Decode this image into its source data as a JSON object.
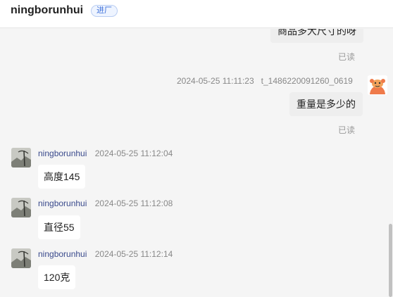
{
  "header": {
    "contact_name": "ningborunhui",
    "status_tag": "进厂"
  },
  "messages": [
    {
      "text": "商品多大尺寸的呀",
      "read": "已读"
    },
    {
      "timestamp": "2024-05-25 11:11:23",
      "sender": "t_1486220091260_0619",
      "text": "重量是多少的",
      "read": "已读"
    },
    {
      "sender": "ningborunhui",
      "timestamp": "2024-05-25 11:12:04",
      "text": "高度145"
    },
    {
      "sender": "ningborunhui",
      "timestamp": "2024-05-25 11:12:08",
      "text": "直径55"
    },
    {
      "sender": "ningborunhui",
      "timestamp": "2024-05-25 11:12:14",
      "text": "120克"
    }
  ]
}
